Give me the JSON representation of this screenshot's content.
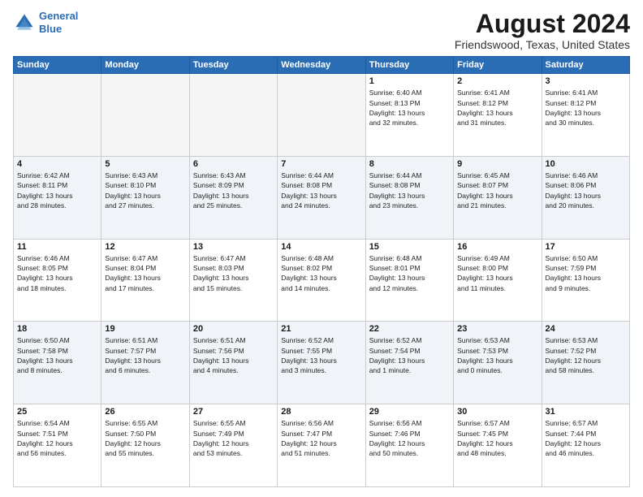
{
  "logo": {
    "line1": "General",
    "line2": "Blue"
  },
  "title": "August 2024",
  "subtitle": "Friendswood, Texas, United States",
  "days_of_week": [
    "Sunday",
    "Monday",
    "Tuesday",
    "Wednesday",
    "Thursday",
    "Friday",
    "Saturday"
  ],
  "weeks": [
    [
      {
        "day": "",
        "info": ""
      },
      {
        "day": "",
        "info": ""
      },
      {
        "day": "",
        "info": ""
      },
      {
        "day": "",
        "info": ""
      },
      {
        "day": "1",
        "info": "Sunrise: 6:40 AM\nSunset: 8:13 PM\nDaylight: 13 hours\nand 32 minutes."
      },
      {
        "day": "2",
        "info": "Sunrise: 6:41 AM\nSunset: 8:12 PM\nDaylight: 13 hours\nand 31 minutes."
      },
      {
        "day": "3",
        "info": "Sunrise: 6:41 AM\nSunset: 8:12 PM\nDaylight: 13 hours\nand 30 minutes."
      }
    ],
    [
      {
        "day": "4",
        "info": "Sunrise: 6:42 AM\nSunset: 8:11 PM\nDaylight: 13 hours\nand 28 minutes."
      },
      {
        "day": "5",
        "info": "Sunrise: 6:43 AM\nSunset: 8:10 PM\nDaylight: 13 hours\nand 27 minutes."
      },
      {
        "day": "6",
        "info": "Sunrise: 6:43 AM\nSunset: 8:09 PM\nDaylight: 13 hours\nand 25 minutes."
      },
      {
        "day": "7",
        "info": "Sunrise: 6:44 AM\nSunset: 8:08 PM\nDaylight: 13 hours\nand 24 minutes."
      },
      {
        "day": "8",
        "info": "Sunrise: 6:44 AM\nSunset: 8:08 PM\nDaylight: 13 hours\nand 23 minutes."
      },
      {
        "day": "9",
        "info": "Sunrise: 6:45 AM\nSunset: 8:07 PM\nDaylight: 13 hours\nand 21 minutes."
      },
      {
        "day": "10",
        "info": "Sunrise: 6:46 AM\nSunset: 8:06 PM\nDaylight: 13 hours\nand 20 minutes."
      }
    ],
    [
      {
        "day": "11",
        "info": "Sunrise: 6:46 AM\nSunset: 8:05 PM\nDaylight: 13 hours\nand 18 minutes."
      },
      {
        "day": "12",
        "info": "Sunrise: 6:47 AM\nSunset: 8:04 PM\nDaylight: 13 hours\nand 17 minutes."
      },
      {
        "day": "13",
        "info": "Sunrise: 6:47 AM\nSunset: 8:03 PM\nDaylight: 13 hours\nand 15 minutes."
      },
      {
        "day": "14",
        "info": "Sunrise: 6:48 AM\nSunset: 8:02 PM\nDaylight: 13 hours\nand 14 minutes."
      },
      {
        "day": "15",
        "info": "Sunrise: 6:48 AM\nSunset: 8:01 PM\nDaylight: 13 hours\nand 12 minutes."
      },
      {
        "day": "16",
        "info": "Sunrise: 6:49 AM\nSunset: 8:00 PM\nDaylight: 13 hours\nand 11 minutes."
      },
      {
        "day": "17",
        "info": "Sunrise: 6:50 AM\nSunset: 7:59 PM\nDaylight: 13 hours\nand 9 minutes."
      }
    ],
    [
      {
        "day": "18",
        "info": "Sunrise: 6:50 AM\nSunset: 7:58 PM\nDaylight: 13 hours\nand 8 minutes."
      },
      {
        "day": "19",
        "info": "Sunrise: 6:51 AM\nSunset: 7:57 PM\nDaylight: 13 hours\nand 6 minutes."
      },
      {
        "day": "20",
        "info": "Sunrise: 6:51 AM\nSunset: 7:56 PM\nDaylight: 13 hours\nand 4 minutes."
      },
      {
        "day": "21",
        "info": "Sunrise: 6:52 AM\nSunset: 7:55 PM\nDaylight: 13 hours\nand 3 minutes."
      },
      {
        "day": "22",
        "info": "Sunrise: 6:52 AM\nSunset: 7:54 PM\nDaylight: 13 hours\nand 1 minute."
      },
      {
        "day": "23",
        "info": "Sunrise: 6:53 AM\nSunset: 7:53 PM\nDaylight: 13 hours\nand 0 minutes."
      },
      {
        "day": "24",
        "info": "Sunrise: 6:53 AM\nSunset: 7:52 PM\nDaylight: 12 hours\nand 58 minutes."
      }
    ],
    [
      {
        "day": "25",
        "info": "Sunrise: 6:54 AM\nSunset: 7:51 PM\nDaylight: 12 hours\nand 56 minutes."
      },
      {
        "day": "26",
        "info": "Sunrise: 6:55 AM\nSunset: 7:50 PM\nDaylight: 12 hours\nand 55 minutes."
      },
      {
        "day": "27",
        "info": "Sunrise: 6:55 AM\nSunset: 7:49 PM\nDaylight: 12 hours\nand 53 minutes."
      },
      {
        "day": "28",
        "info": "Sunrise: 6:56 AM\nSunset: 7:47 PM\nDaylight: 12 hours\nand 51 minutes."
      },
      {
        "day": "29",
        "info": "Sunrise: 6:56 AM\nSunset: 7:46 PM\nDaylight: 12 hours\nand 50 minutes."
      },
      {
        "day": "30",
        "info": "Sunrise: 6:57 AM\nSunset: 7:45 PM\nDaylight: 12 hours\nand 48 minutes."
      },
      {
        "day": "31",
        "info": "Sunrise: 6:57 AM\nSunset: 7:44 PM\nDaylight: 12 hours\nand 46 minutes."
      }
    ]
  ]
}
